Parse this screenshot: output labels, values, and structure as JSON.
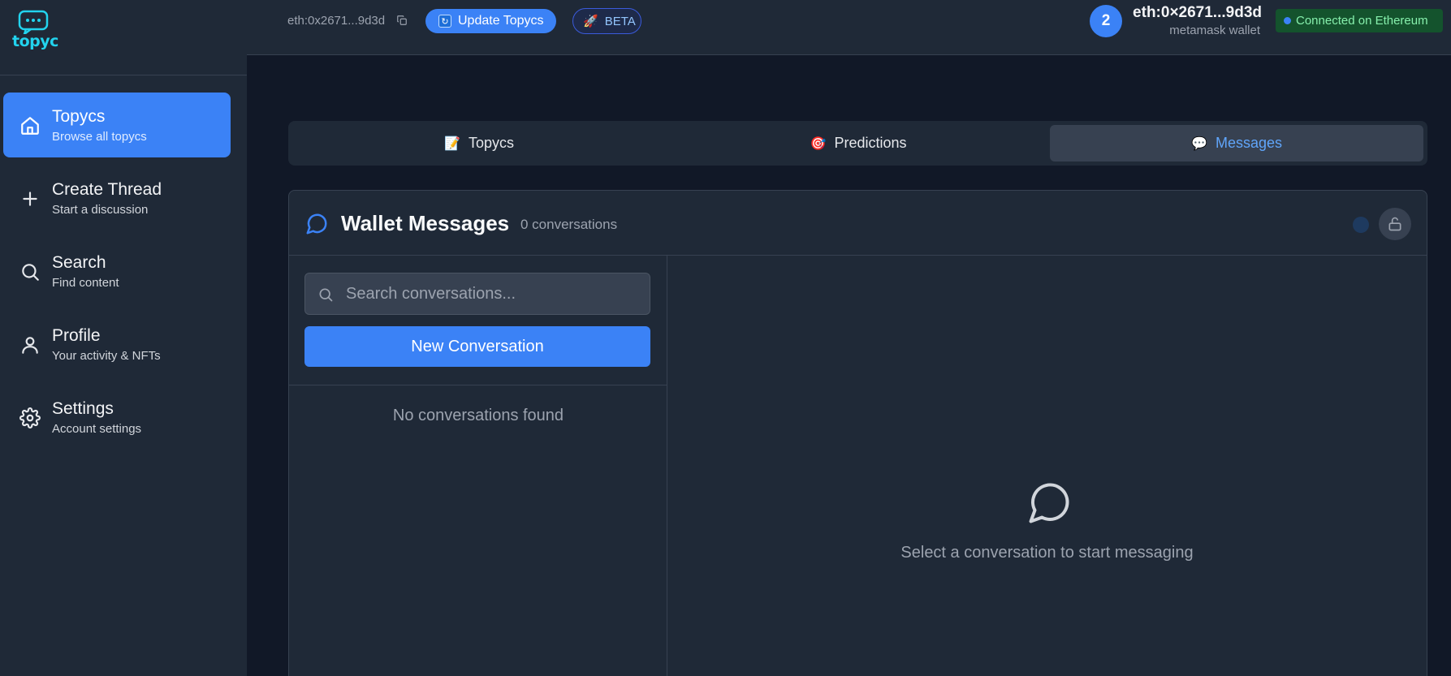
{
  "app": {
    "logo_text": "topyc"
  },
  "sidebar": {
    "items": [
      {
        "title": "Topycs",
        "subtitle": "Browse all topycs",
        "icon": "home-icon"
      },
      {
        "title": "Create Thread",
        "subtitle": "Start a discussion",
        "icon": "plus-icon"
      },
      {
        "title": "Search",
        "subtitle": "Find content",
        "icon": "search-icon"
      },
      {
        "title": "Profile",
        "subtitle": "Your activity & NFTs",
        "icon": "user-icon"
      },
      {
        "title": "Settings",
        "subtitle": "Account settings",
        "icon": "gear-icon"
      }
    ]
  },
  "header": {
    "short_address": "eth:0x2671...9d3d",
    "update_label": "Update Topycs",
    "beta_label": "BETA",
    "avatar_count": "2",
    "wallet_address": "eth:0×2671...9d3d",
    "wallet_type": "metamask wallet",
    "connection_status": "Connected on Ethereum"
  },
  "tabs": [
    {
      "label": "Topycs",
      "icon": "📝"
    },
    {
      "label": "Predictions",
      "icon": "🎯"
    },
    {
      "label": "Messages",
      "icon": "💬"
    }
  ],
  "messages": {
    "title": "Wallet Messages",
    "count_label": "0 conversations",
    "search_placeholder": "Search conversations...",
    "new_conversation_label": "New Conversation",
    "empty_list_text": "No conversations found",
    "empty_state_text": "Select a conversation to start messaging"
  },
  "colors": {
    "accent": "#3b82f6",
    "background": "#111827",
    "surface": "#1f2937",
    "connected_bg": "#14532d",
    "connected_text": "#86efac"
  }
}
